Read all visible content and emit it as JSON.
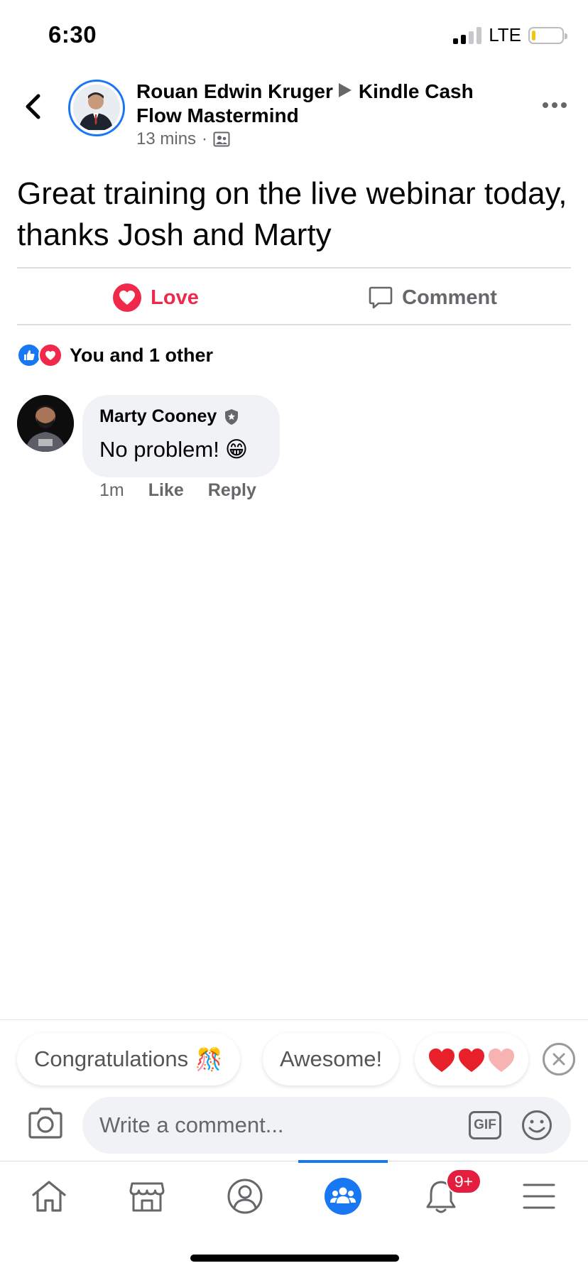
{
  "status_bar": {
    "time": "6:30",
    "network": "LTE",
    "signal_bars_active": 2,
    "signal_bars_total": 4,
    "battery_level": 0.12,
    "battery_color": "#f4c40b"
  },
  "post": {
    "author": "Rouan Edwin Kruger",
    "group": "Kindle Cash Flow Mastermind",
    "time": "13 mins",
    "privacy_icon": "group-members-icon",
    "text": "Great training on the live webinar today, thanks Josh and Marty"
  },
  "actions": {
    "love_label": "Love",
    "comment_label": "Comment"
  },
  "reactions": {
    "summary": "You and 1 other",
    "icons": [
      "like-icon",
      "heart-icon"
    ]
  },
  "comments": [
    {
      "author": "Marty Cooney",
      "badge_icon": "admin-shield-icon",
      "text": "No problem!",
      "emoji": "😁",
      "time": "1m",
      "like_label": "Like",
      "reply_label": "Reply"
    }
  ],
  "quick_replies": {
    "chips": [
      "Congratulations",
      "Awesome!"
    ],
    "chip_emojis": [
      "🎊",
      "❤️❤️"
    ]
  },
  "composer": {
    "placeholder": "Write a comment...",
    "gif_label": "GIF"
  },
  "tab_bar": {
    "tabs": [
      "home-icon",
      "marketplace-icon",
      "profile-icon",
      "groups-icon",
      "notifications-icon",
      "menu-icon"
    ],
    "active_tab": "groups-icon",
    "notification_badge": "9+"
  },
  "colors": {
    "accent": "#1877f2",
    "love": "#f02849",
    "muted": "#65676b"
  }
}
